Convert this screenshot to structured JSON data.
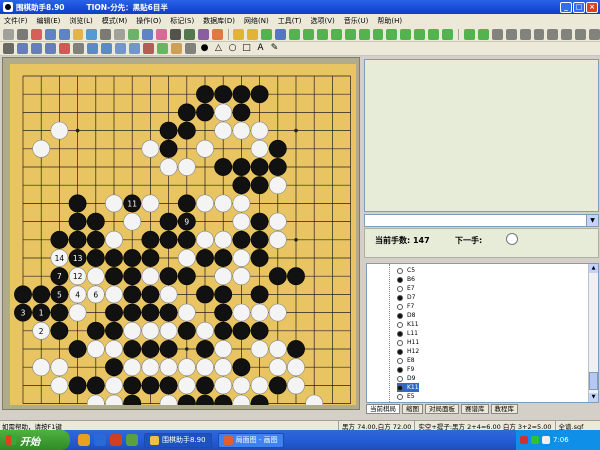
{
  "window": {
    "title": "围棋助手8.90",
    "subtitle": "TION-分先：黑贴6目半",
    "min": "_",
    "max": "□",
    "close": "×"
  },
  "menu": [
    "文件(F)",
    "编辑(E)",
    "浏览(L)",
    "模式(M)",
    "操作(O)",
    "标记(S)",
    "数据库(D)",
    "网络(N)",
    "工具(T)",
    "选项(V)",
    "音乐(U)",
    "帮助(H)"
  ],
  "colors": {
    "board": "#e8c462",
    "accent": "#0a3fc6",
    "panel": "#e6ecd8"
  },
  "board": {
    "black": [
      [
        9,
        4
      ],
      [
        9,
        5
      ],
      [
        10,
        3
      ],
      [
        10,
        4
      ],
      [
        11,
        2
      ],
      [
        11,
        3
      ],
      [
        12,
        2
      ],
      [
        13,
        2
      ],
      [
        14,
        2
      ],
      [
        13,
        3
      ],
      [
        15,
        5
      ],
      [
        15,
        6
      ],
      [
        14,
        7
      ],
      [
        14,
        6
      ],
      [
        12,
        6
      ],
      [
        13,
        6
      ],
      [
        13,
        7
      ],
      [
        13,
        10
      ],
      [
        14,
        9
      ],
      [
        14,
        10
      ],
      [
        14,
        11
      ],
      [
        12,
        11
      ],
      [
        11,
        11
      ],
      [
        10,
        8
      ],
      [
        10,
        9
      ],
      [
        10,
        10
      ],
      [
        9,
        9
      ],
      [
        9,
        10
      ],
      [
        8,
        11
      ],
      [
        7,
        11
      ],
      [
        4,
        8
      ],
      [
        4,
        9
      ],
      [
        5,
        9
      ],
      [
        5,
        10
      ],
      [
        6,
        11
      ],
      [
        7,
        12
      ],
      [
        4,
        10
      ],
      [
        3,
        10
      ],
      [
        3,
        11
      ],
      [
        4,
        11
      ],
      [
        1,
        13
      ],
      [
        2,
        13
      ],
      [
        2,
        14
      ],
      [
        2,
        15
      ],
      [
        3,
        14
      ],
      [
        3,
        15
      ],
      [
        4,
        16
      ],
      [
        5,
        15
      ],
      [
        6,
        15
      ],
      [
        6,
        14
      ],
      [
        7,
        14
      ],
      [
        7,
        13
      ],
      [
        8,
        14
      ],
      [
        9,
        14
      ],
      [
        10,
        15
      ],
      [
        9,
        16
      ],
      [
        11,
        16
      ],
      [
        12,
        15
      ],
      [
        13,
        15
      ],
      [
        14,
        15
      ],
      [
        12,
        14
      ],
      [
        11,
        13
      ],
      [
        12,
        13
      ],
      [
        10,
        12
      ],
      [
        9,
        12
      ],
      [
        8,
        13
      ],
      [
        7,
        16
      ],
      [
        8,
        16
      ],
      [
        6,
        17
      ],
      [
        4,
        18
      ],
      [
        5,
        18
      ],
      [
        7,
        19
      ],
      [
        8,
        18
      ],
      [
        9,
        18
      ],
      [
        10,
        19
      ],
      [
        11,
        19
      ],
      [
        12,
        19
      ],
      [
        13,
        20
      ],
      [
        14,
        20
      ],
      [
        14,
        19
      ],
      [
        15,
        18
      ],
      [
        16,
        16
      ],
      [
        15,
        12
      ],
      [
        16,
        12
      ],
      [
        14,
        13
      ],
      [
        13,
        17
      ],
      [
        11,
        18
      ],
      [
        9,
        20
      ],
      [
        10,
        21
      ],
      [
        12,
        21
      ],
      [
        7,
        18
      ],
      [
        6,
        12
      ],
      [
        5,
        11
      ],
      [
        8,
        10
      ]
    ],
    "white": [
      [
        3,
        4
      ],
      [
        2,
        5
      ],
      [
        8,
        5
      ],
      [
        9,
        6
      ],
      [
        10,
        6
      ],
      [
        11,
        5
      ],
      [
        12,
        4
      ],
      [
        12,
        3
      ],
      [
        13,
        4
      ],
      [
        14,
        4
      ],
      [
        14,
        5
      ],
      [
        15,
        7
      ],
      [
        13,
        8
      ],
      [
        12,
        8
      ],
      [
        11,
        8
      ],
      [
        13,
        9
      ],
      [
        12,
        10
      ],
      [
        15,
        9
      ],
      [
        15,
        10
      ],
      [
        8,
        8
      ],
      [
        7,
        8
      ],
      [
        6,
        8
      ],
      [
        6,
        10
      ],
      [
        5,
        10
      ],
      [
        3,
        12
      ],
      [
        3,
        13
      ],
      [
        4,
        13
      ],
      [
        4,
        12
      ],
      [
        5,
        12
      ],
      [
        6,
        13
      ],
      [
        6,
        16
      ],
      [
        7,
        9
      ],
      [
        8,
        12
      ],
      [
        10,
        11
      ],
      [
        11,
        10
      ],
      [
        12,
        10
      ],
      [
        12,
        12
      ],
      [
        13,
        11
      ],
      [
        13,
        12
      ],
      [
        13,
        14
      ],
      [
        14,
        14
      ],
      [
        15,
        14
      ],
      [
        14,
        16
      ],
      [
        16,
        17
      ],
      [
        15,
        16
      ],
      [
        12,
        16
      ],
      [
        12,
        17
      ],
      [
        11,
        17
      ],
      [
        10,
        17
      ],
      [
        11,
        15
      ],
      [
        10,
        14
      ],
      [
        9,
        13
      ],
      [
        8,
        15
      ],
      [
        8,
        17
      ],
      [
        7,
        17
      ],
      [
        9,
        19
      ],
      [
        10,
        18
      ],
      [
        10,
        20
      ],
      [
        9,
        15
      ],
      [
        8,
        20
      ],
      [
        7,
        20
      ],
      [
        6,
        18
      ],
      [
        5,
        16
      ],
      [
        4,
        14
      ],
      [
        3,
        17
      ],
      [
        2,
        17
      ],
      [
        3,
        18
      ],
      [
        12,
        18
      ],
      [
        13,
        18
      ],
      [
        14,
        18
      ],
      [
        15,
        17
      ],
      [
        16,
        18
      ],
      [
        17,
        19
      ],
      [
        6,
        19
      ],
      [
        5,
        19
      ],
      [
        6,
        20
      ],
      [
        13,
        19
      ],
      [
        12,
        20
      ],
      [
        11,
        20
      ],
      [
        7,
        15
      ],
      [
        9,
        17
      ],
      [
        2,
        14
      ]
    ],
    "labels": [
      {
        "n": "11",
        "x": 7,
        "y": 8,
        "c": "b"
      },
      {
        "n": "9",
        "x": 10,
        "y": 9,
        "c": "b"
      },
      {
        "n": "14",
        "x": 3,
        "y": 11,
        "c": "w"
      },
      {
        "n": "13",
        "x": 4,
        "y": 11,
        "c": "b"
      },
      {
        "n": "7",
        "x": 3,
        "y": 12,
        "c": "b"
      },
      {
        "n": "12",
        "x": 4,
        "y": 12,
        "c": "w"
      },
      {
        "n": "5",
        "x": 3,
        "y": 13,
        "c": "b"
      },
      {
        "n": "4",
        "x": 4,
        "y": 13,
        "c": "w"
      },
      {
        "n": "6",
        "x": 5,
        "y": 13,
        "c": "w"
      },
      {
        "n": "3",
        "x": 1,
        "y": 14,
        "c": "b"
      },
      {
        "n": "1",
        "x": 2,
        "y": 14,
        "c": "b"
      },
      {
        "n": "2",
        "x": 2,
        "y": 15,
        "c": "w"
      }
    ]
  },
  "info": {
    "moves_label": "当前手数: 147",
    "next_label": "下一手:"
  },
  "tree": [
    {
      "t": "C5",
      "c": "w"
    },
    {
      "t": "B6",
      "c": "b"
    },
    {
      "t": "E7",
      "c": "w"
    },
    {
      "t": "D7",
      "c": "b"
    },
    {
      "t": "F7",
      "c": "w"
    },
    {
      "t": "D8",
      "c": "b"
    },
    {
      "t": "K11",
      "c": "w"
    },
    {
      "t": "L11",
      "c": "b"
    },
    {
      "t": "H11",
      "c": "w"
    },
    {
      "t": "H12",
      "c": "b"
    },
    {
      "t": "E8",
      "c": "w"
    },
    {
      "t": "F9",
      "c": "b"
    },
    {
      "t": "D9",
      "c": "w"
    },
    {
      "t": "K11",
      "c": "b",
      "sel": true
    },
    {
      "t": "E5",
      "c": "w"
    }
  ],
  "tabs": [
    "当前棋局",
    "缩图",
    "对局面板",
    "赛谱库",
    "教程库"
  ],
  "status": {
    "hint": "如需帮助，请按F1键",
    "cells": [
      "黑方 74.00,白方 72.00",
      "实空+提子:黑方 2+4=6.00 白方 3+2=5.00",
      "全谱.sgf"
    ]
  },
  "taskbar": {
    "start": "开始",
    "tasks": [
      "围棋助手8.90",
      "局面图 - 画图"
    ],
    "clock": "7:06"
  }
}
